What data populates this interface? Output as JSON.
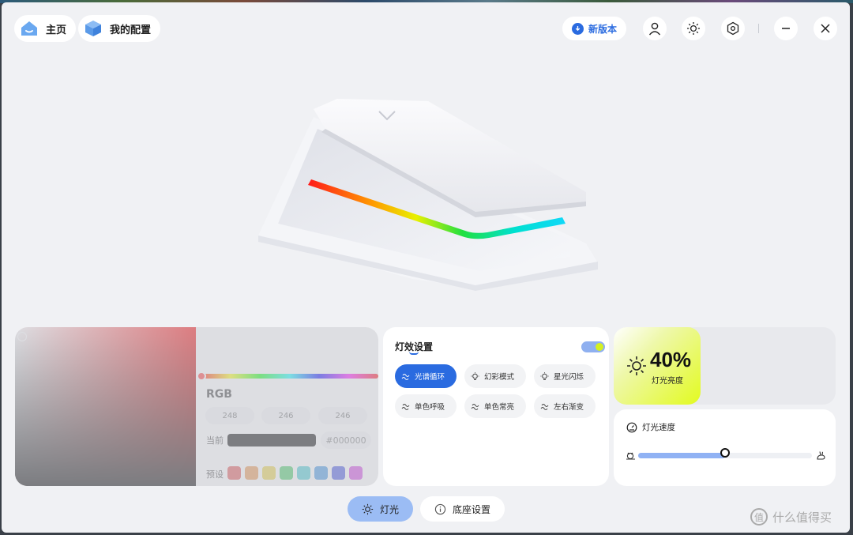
{
  "header": {
    "home_label": "主页",
    "config_label": "我的配置",
    "new_version_label": "新版本"
  },
  "color_picker": {
    "rgb_label": "RGB",
    "r": "248",
    "g": "246",
    "b": "246",
    "current_label": "当前",
    "hex_value": "#000000",
    "preset_label": "预设",
    "presets": [
      "#e05050",
      "#e89048",
      "#e6d040",
      "#40c860",
      "#40c8d0",
      "#3a90e0",
      "#4050e0",
      "#d040e0"
    ]
  },
  "effects": {
    "title": "灯效设置",
    "enabled": true,
    "modes": [
      {
        "label": "光谱循环",
        "icon": "wave-icon",
        "active": true
      },
      {
        "label": "幻彩模式",
        "icon": "bulb-icon",
        "active": false
      },
      {
        "label": "星光闪烁",
        "icon": "bulb-icon",
        "active": false
      },
      {
        "label": "单色呼吸",
        "icon": "wave-icon",
        "active": false
      },
      {
        "label": "单色常亮",
        "icon": "wave-icon",
        "active": false
      },
      {
        "label": "左右渐变",
        "icon": "wave-icon",
        "active": false
      }
    ]
  },
  "brightness": {
    "value": "40%",
    "label": "灯光亮度"
  },
  "speed": {
    "title": "灯光速度",
    "level": 0.5
  },
  "tabs": {
    "light_label": "灯光",
    "base_label": "底座设置"
  },
  "watermark": "什么值得买",
  "colors": {
    "accent": "#2a6be0",
    "highlight": "#e2fa20"
  }
}
